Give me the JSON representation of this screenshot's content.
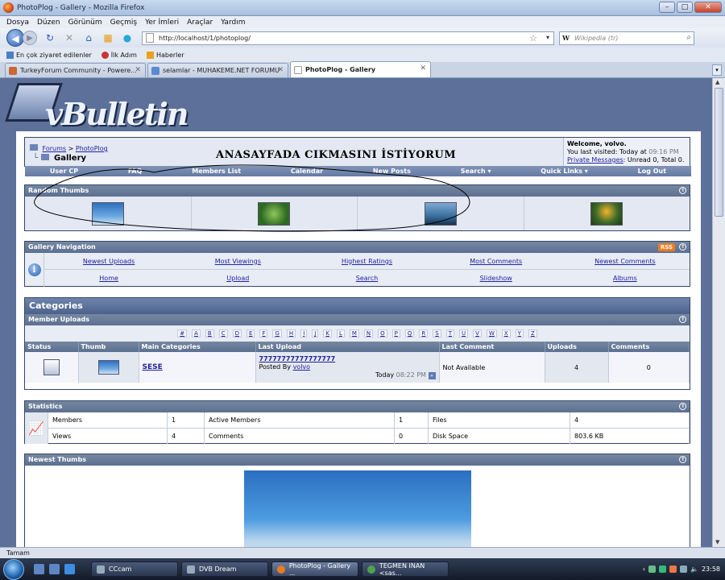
{
  "window": {
    "title": "PhotoPlog - Gallery - Mozilla Firefox"
  },
  "menu": [
    "Dosya",
    "Düzen",
    "Görünüm",
    "Geçmiş",
    "Yer İmleri",
    "Araçlar",
    "Yardım"
  ],
  "urlbar": {
    "url": "http://localhost/1/photoplog/"
  },
  "search": {
    "engine": "W",
    "placeholder": "Wikipedia (tr)"
  },
  "bookmarks": [
    "En çok ziyaret edilenler",
    "İlk Adım",
    "Haberler"
  ],
  "tabs": [
    {
      "label": "TurkeyForum Community - Powere..."
    },
    {
      "label": "selamlar - MUHAKEME.NET FORUMU"
    },
    {
      "label": "PhotoPlog - Gallery"
    }
  ],
  "logo": {
    "text": "vBulletin"
  },
  "breadcrumb": {
    "forums": "Forums",
    "photoplog": "PhotoPlog",
    "current": "Gallery"
  },
  "annotation": "ANASAYFADA CIKMASINI İSTİYORUM",
  "welcome": {
    "greeting": "Welcome, volvo.",
    "last_visit_label": "You last visited: Today at",
    "last_visit_time": "09:16 PM",
    "pm_link": "Private Messages",
    "pm_status": ": Unread 0, Total 0."
  },
  "navrow": [
    "User CP",
    "FAQ",
    "Members List",
    "Calendar",
    "New Posts",
    "Search ▾",
    "Quick Links ▾",
    "Log Out"
  ],
  "random_thumbs": {
    "title": "Random Thumbs"
  },
  "gallery_nav": {
    "title": "Gallery Navigation",
    "rss": "RSS",
    "row1": [
      "Newest Uploads",
      "Most Viewings",
      "Highest Ratings",
      "Most Comments",
      "Newest Comments"
    ],
    "row2": [
      "Home",
      "Upload",
      "Search",
      "Slideshow",
      "Albums"
    ]
  },
  "categories": {
    "title": "Categories",
    "subtitle": "Member Uploads",
    "letters": [
      "#",
      "A",
      "B",
      "C",
      "D",
      "E",
      "F",
      "G",
      "H",
      "I",
      "J",
      "K",
      "L",
      "M",
      "N",
      "O",
      "P",
      "Q",
      "R",
      "S",
      "T",
      "U",
      "V",
      "W",
      "X",
      "Y",
      "Z"
    ],
    "headers": [
      "Status",
      "Thumb",
      "Main Categories",
      "Last Upload",
      "Last Comment",
      "Uploads",
      "Comments"
    ],
    "row": {
      "category": "SESE",
      "last_upload_title": "77777777777777777",
      "posted_by_label": "Posted By",
      "posted_by": "volvo",
      "upload_day": "Today",
      "upload_time": "08:22 PM",
      "last_comment": "Not Available",
      "uploads": "4",
      "comments": "0"
    }
  },
  "statistics": {
    "title": "Statistics",
    "members_label": "Members",
    "members": "1",
    "active_label": "Active Members",
    "active": "1",
    "files_label": "Files",
    "files": "4",
    "views_label": "Views",
    "views": "4",
    "comments_label": "Comments",
    "comments": "0",
    "disk_label": "Disk Space",
    "disk": "803.6 KB"
  },
  "newest_thumbs": {
    "title": "Newest Thumbs"
  },
  "statusbar": {
    "text": "Tamam"
  },
  "taskbar": {
    "tasks": [
      "CCcam",
      "DVB Dream",
      "PhotoPlog - Gallery ...",
      "TEGMEN INAN <sas..."
    ],
    "clock": "23:58"
  }
}
